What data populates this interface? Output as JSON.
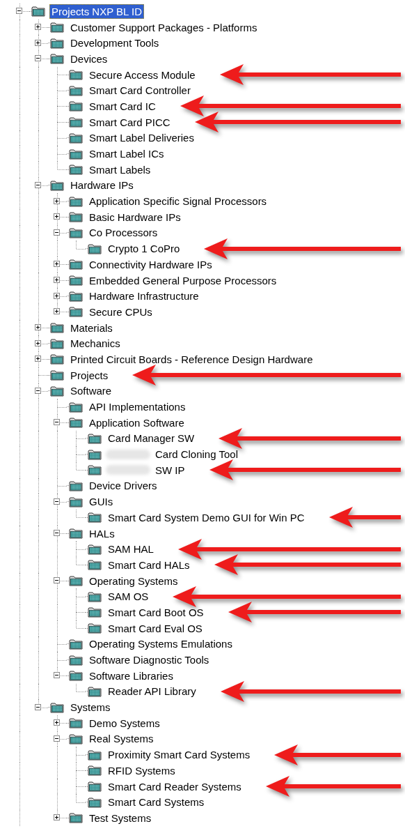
{
  "tree": [
    {
      "label": "Projects NXP BL ID",
      "expanded": true,
      "selected": true,
      "marked": false,
      "children": [
        {
          "label": "Customer Support Packages - Platforms",
          "expanded": false,
          "selected": false,
          "marked": false
        },
        {
          "label": "Development Tools",
          "expanded": false,
          "selected": false,
          "marked": false
        },
        {
          "label": "Devices",
          "expanded": true,
          "selected": false,
          "marked": false,
          "children": [
            {
              "label": "Secure Access Module",
              "selected": false,
              "marked": true
            },
            {
              "label": "Smart Card Controller",
              "selected": false,
              "marked": false
            },
            {
              "label": "Smart Card IC",
              "selected": false,
              "marked": true
            },
            {
              "label": "Smart Card PICC",
              "selected": false,
              "marked": true
            },
            {
              "label": "Smart Label Deliveries",
              "selected": false,
              "marked": false
            },
            {
              "label": "Smart Label ICs",
              "selected": false,
              "marked": false
            },
            {
              "label": "Smart Labels",
              "selected": false,
              "marked": false
            }
          ]
        },
        {
          "label": "Hardware IPs",
          "expanded": true,
          "selected": false,
          "marked": false,
          "children": [
            {
              "label": "Application Specific Signal Processors",
              "expanded": false,
              "selected": false,
              "marked": false
            },
            {
              "label": "Basic Hardware IPs",
              "expanded": false,
              "selected": false,
              "marked": false
            },
            {
              "label": "Co Processors",
              "expanded": true,
              "selected": false,
              "marked": false,
              "children": [
                {
                  "label": "Crypto 1 CoPro",
                  "selected": false,
                  "marked": true
                }
              ]
            },
            {
              "label": "Connectivity Hardware IPs",
              "expanded": false,
              "selected": false,
              "marked": false
            },
            {
              "label": "Embedded General Purpose Processors",
              "expanded": false,
              "selected": false,
              "marked": false
            },
            {
              "label": "Hardware Infrastructure",
              "expanded": false,
              "selected": false,
              "marked": false
            },
            {
              "label": "Secure CPUs",
              "expanded": false,
              "selected": false,
              "marked": false
            }
          ]
        },
        {
          "label": "Materials",
          "expanded": false,
          "selected": false,
          "marked": false
        },
        {
          "label": "Mechanics",
          "expanded": false,
          "selected": false,
          "marked": false
        },
        {
          "label": "Printed Circuit Boards - Reference Design Hardware",
          "expanded": false,
          "selected": false,
          "marked": false
        },
        {
          "label": "Projects",
          "selected": false,
          "marked": true
        },
        {
          "label": "Software",
          "expanded": true,
          "selected": false,
          "marked": false,
          "children": [
            {
              "label": "API Implementations",
              "selected": false,
              "marked": false
            },
            {
              "label": "Application Software",
              "expanded": true,
              "selected": false,
              "marked": false,
              "children": [
                {
                  "label": "Card Manager SW",
                  "selected": false,
                  "marked": true
                },
                {
                  "label": "Card Cloning Tool",
                  "redacted": true,
                  "selected": false,
                  "marked": false
                },
                {
                  "label": "SW IP",
                  "redacted": true,
                  "selected": false,
                  "marked": true
                }
              ]
            },
            {
              "label": "Device Drivers",
              "selected": false,
              "marked": false
            },
            {
              "label": "GUIs",
              "expanded": true,
              "selected": false,
              "marked": false,
              "children": [
                {
                  "label": "Smart Card System Demo GUI for Win PC",
                  "selected": false,
                  "marked": true
                }
              ]
            },
            {
              "label": "HALs",
              "expanded": true,
              "selected": false,
              "marked": false,
              "children": [
                {
                  "label": "SAM HAL",
                  "selected": false,
                  "marked": true
                },
                {
                  "label": "Smart Card HALs",
                  "selected": false,
                  "marked": true
                }
              ]
            },
            {
              "label": "Operating Systems",
              "expanded": true,
              "selected": false,
              "marked": false,
              "children": [
                {
                  "label": "SAM OS",
                  "selected": false,
                  "marked": true
                },
                {
                  "label": "Smart Card Boot OS",
                  "selected": false,
                  "marked": true
                },
                {
                  "label": "Smart Card Eval OS",
                  "selected": false,
                  "marked": false
                }
              ]
            },
            {
              "label": "Operating Systems Emulations",
              "selected": false,
              "marked": false
            },
            {
              "label": "Software Diagnostic Tools",
              "selected": false,
              "marked": false
            },
            {
              "label": "Software Libraries",
              "expanded": true,
              "selected": false,
              "marked": false,
              "children": [
                {
                  "label": "Reader API Library",
                  "selected": false,
                  "marked": true
                }
              ]
            }
          ]
        },
        {
          "label": "Systems",
          "expanded": true,
          "selected": false,
          "marked": false,
          "children": [
            {
              "label": "Demo Systems",
              "expanded": false,
              "selected": false,
              "marked": false
            },
            {
              "label": "Real Systems",
              "expanded": true,
              "selected": false,
              "marked": false,
              "children": [
                {
                  "label": "Proximity Smart Card Systems",
                  "selected": false,
                  "marked": true
                },
                {
                  "label": "RFID Systems",
                  "selected": false,
                  "marked": false
                },
                {
                  "label": "Smart Card Reader Systems",
                  "selected": false,
                  "marked": true
                },
                {
                  "label": "Smart Card Systems",
                  "selected": false,
                  "marked": false
                }
              ]
            },
            {
              "label": "Test Systems",
              "expanded": false,
              "selected": false,
              "marked": false
            }
          ]
        }
      ]
    }
  ]
}
